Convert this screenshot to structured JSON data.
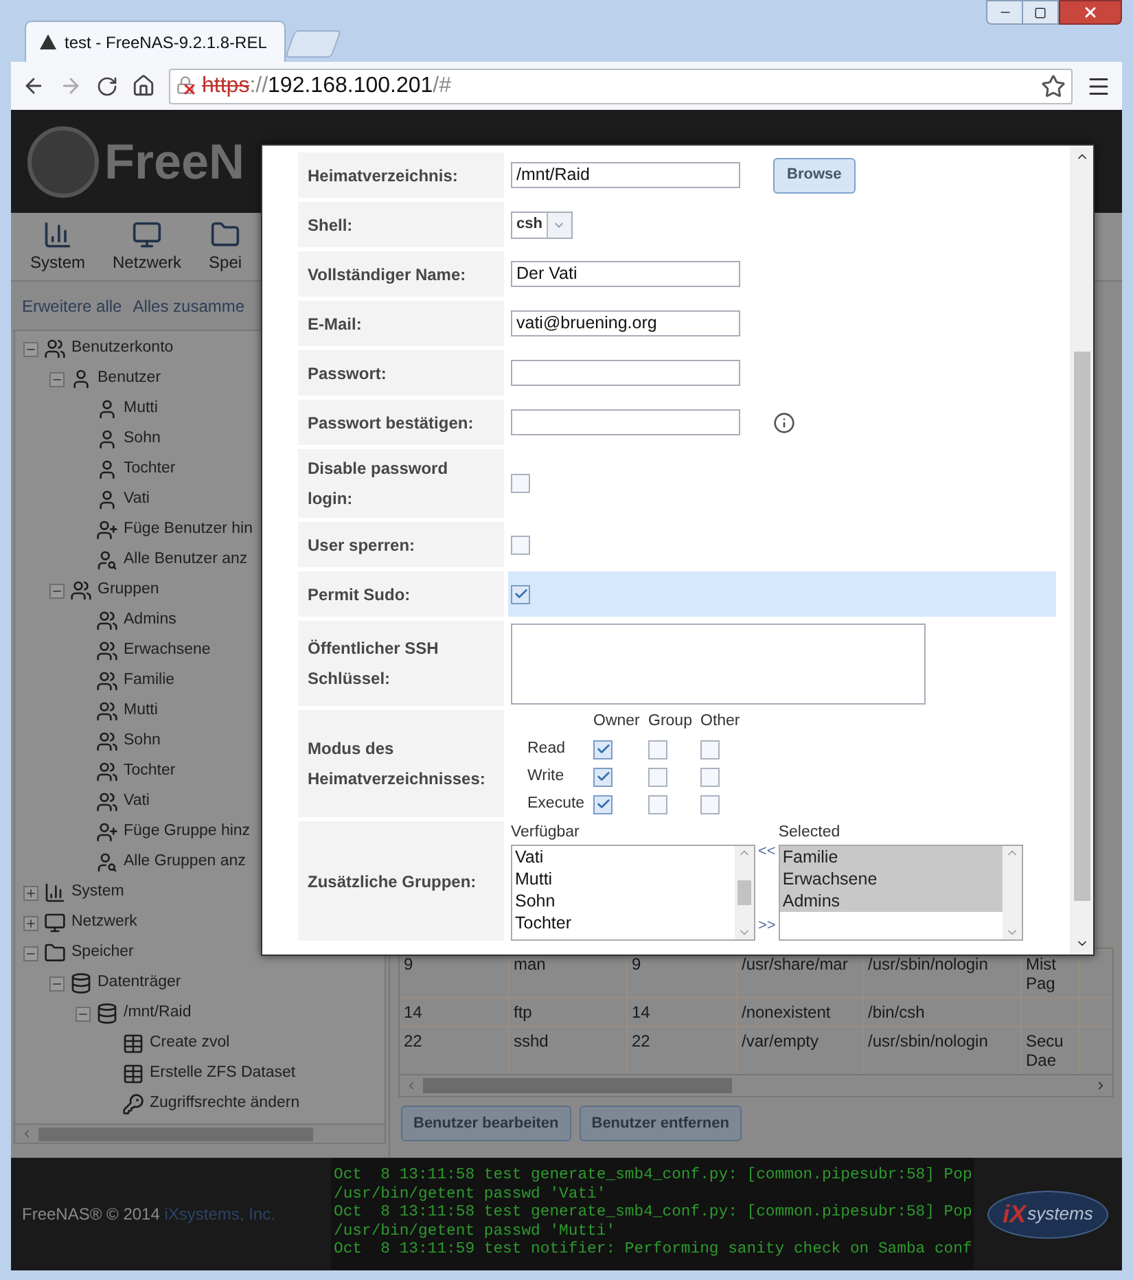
{
  "browser": {
    "tab_title": "test - FreeNAS-9.2.1.8-REL",
    "url": {
      "scheme": "https",
      "separator": "://",
      "host": "192.168.100.201",
      "path": "/#",
      "insecure": true
    }
  },
  "header": {
    "logo_text": "FreeN"
  },
  "toolbar": [
    {
      "label": "System",
      "kind": "system"
    },
    {
      "label": "Netzwerk",
      "kind": "network"
    },
    {
      "label": "Spei",
      "kind": "folder"
    }
  ],
  "tree_actions": [
    "Erweitere alle",
    "Alles zusamme"
  ],
  "tree": [
    {
      "label": "Benutzerkonto",
      "kind": "account",
      "expanded": true,
      "children": [
        {
          "label": "Benutzer",
          "kind": "userfolder",
          "expanded": true,
          "children": [
            {
              "label": "Mutti",
              "kind": "user"
            },
            {
              "label": "Sohn",
              "kind": "user"
            },
            {
              "label": "Tochter",
              "kind": "user"
            },
            {
              "label": "Vati",
              "kind": "user"
            },
            {
              "label": "Füge Benutzer hin",
              "kind": "adduser"
            },
            {
              "label": "Alle Benutzer anz",
              "kind": "finduser"
            }
          ]
        },
        {
          "label": "Gruppen",
          "kind": "groupfolder",
          "expanded": true,
          "children": [
            {
              "label": "Admins",
              "kind": "group"
            },
            {
              "label": "Erwachsene",
              "kind": "group"
            },
            {
              "label": "Familie",
              "kind": "group"
            },
            {
              "label": "Mutti",
              "kind": "group"
            },
            {
              "label": "Sohn",
              "kind": "group"
            },
            {
              "label": "Tochter",
              "kind": "group"
            },
            {
              "label": "Vati",
              "kind": "group"
            },
            {
              "label": "Füge Gruppe hinz",
              "kind": "adduser"
            },
            {
              "label": "Alle Gruppen anz",
              "kind": "finduser"
            }
          ]
        }
      ]
    },
    {
      "label": "System",
      "kind": "system",
      "expanded": false
    },
    {
      "label": "Netzwerk",
      "kind": "network",
      "expanded": false
    },
    {
      "label": "Speicher",
      "kind": "folder",
      "expanded": true,
      "children": [
        {
          "label": "Datenträger",
          "kind": "disk",
          "expanded": true,
          "children": [
            {
              "label": "/mnt/Raid",
              "kind": "disk",
              "expanded": true,
              "children": [
                {
                  "label": "Create zvol",
                  "kind": "table"
                },
                {
                  "label": "Erstelle ZFS Dataset",
                  "kind": "table"
                },
                {
                  "label": "Zugriffsrechte ändern",
                  "kind": "key"
                }
              ]
            }
          ]
        }
      ]
    }
  ],
  "table": {
    "rows": [
      [
        "9",
        "man",
        "9",
        "/usr/share/mar",
        "/usr/sbin/nologin",
        "Mist Pag"
      ],
      [
        "14",
        "ftp",
        "14",
        "/nonexistent",
        "/bin/csh",
        ""
      ],
      [
        "22",
        "sshd",
        "22",
        "/var/empty",
        "/usr/sbin/nologin",
        "Secu Dae"
      ]
    ]
  },
  "actions": [
    "Benutzer bearbeiten",
    "Benutzer entfernen"
  ],
  "footer": {
    "copyright": "FreeNAS® © 2014",
    "company_link": "iXsystems, Inc.",
    "logo_mark": "iX",
    "logo_text": "systems",
    "log": [
      "Oct  8 13:11:58 test generate_smb4_conf.py: [common.pipesubr:58] Pop",
      "/usr/bin/getent passwd 'Vati'",
      "Oct  8 13:11:58 test generate_smb4_conf.py: [common.pipesubr:58] Pop",
      "/usr/bin/getent passwd 'Mutti'",
      "Oct  8 13:11:59 test notifier: Performing sanity check on Samba conf"
    ]
  },
  "dialog": {
    "fields": [
      {
        "kind": "text",
        "label": "Heimatverzeichnis:",
        "value": "/mnt/Raid",
        "button": "Browse"
      },
      {
        "kind": "select",
        "label": "Shell:",
        "value": "csh"
      },
      {
        "kind": "text",
        "label": "Vollständiger Name:",
        "value": "Der Vati"
      },
      {
        "kind": "text",
        "label": "E-Mail:",
        "value": "vati@bruening.org"
      },
      {
        "kind": "password",
        "label": "Passwort:"
      },
      {
        "kind": "password",
        "label": "Passwort bestätigen:",
        "info": true
      },
      {
        "kind": "checkbox",
        "label": "Disable password login:",
        "checked": false,
        "highlighted": false
      },
      {
        "kind": "checkbox",
        "label": "User sperren:",
        "checked": false,
        "highlighted": false
      },
      {
        "kind": "checkbox",
        "label": "Permit Sudo:",
        "checked": true,
        "highlighted": true
      },
      {
        "kind": "textarea",
        "label": "Öffentlicher SSH Schlüssel:"
      },
      {
        "kind": "mode",
        "label": "Modus des Heimatverzeichnisses:",
        "columns": [
          "Owner",
          "Group",
          "Other"
        ],
        "rows": [
          {
            "label": "Read",
            "checks": [
              true,
              false,
              false
            ]
          },
          {
            "label": "Write",
            "checks": [
              true,
              false,
              false
            ]
          },
          {
            "label": "Execute",
            "checks": [
              true,
              false,
              false
            ]
          }
        ]
      },
      {
        "kind": "groups",
        "label": "Zusätzliche Gruppen:",
        "available_label": "Verfügbar",
        "available": [
          "Vati",
          "Mutti",
          "Sohn",
          "Tochter"
        ],
        "remove": "<<",
        "add": ">>",
        "selected_label": "Selected",
        "selected": [
          {
            "label": "Familie",
            "selected": true
          },
          {
            "label": "Erwachsene",
            "selected": true
          },
          {
            "label": "Admins",
            "selected": true
          }
        ]
      }
    ]
  }
}
